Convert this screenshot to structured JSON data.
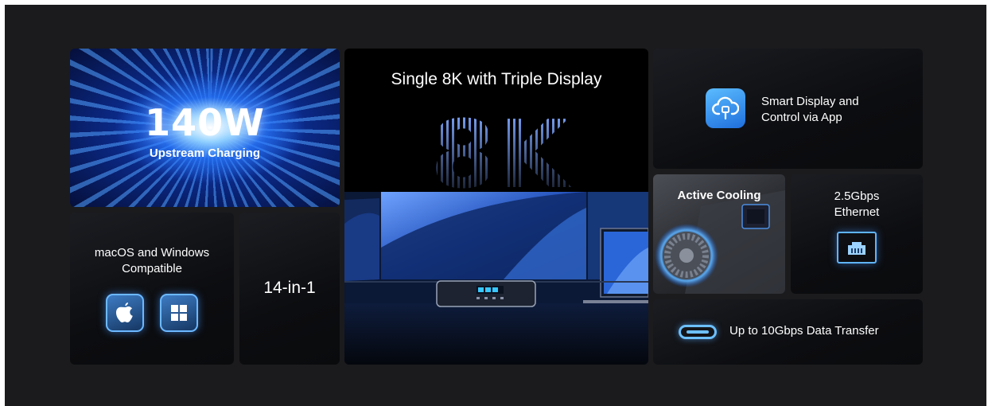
{
  "tiles": {
    "charging": {
      "headline": "140W",
      "subtitle": "Upstream Charging"
    },
    "os": {
      "title_line1": "macOS and Windows",
      "title_line2": "Compatible"
    },
    "ports": {
      "label": "14-in-1"
    },
    "display": {
      "title": "Single 8K with Triple Display",
      "graphic_text": "8K"
    },
    "app": {
      "line1": "Smart Display and",
      "line2": "Control via App"
    },
    "cooling": {
      "label": "Active Cooling"
    },
    "ethernet": {
      "line1": "2.5Gbps",
      "line2": "Ethernet"
    },
    "data": {
      "label": "Up to 10Gbps Data Transfer"
    }
  },
  "icons": {
    "os": [
      "apple-logo-icon",
      "windows-logo-icon"
    ],
    "app": "cloud-usb-icon",
    "ethernet": "ethernet-port-icon",
    "data": "usb-c-port-icon"
  },
  "colors": {
    "background": "#1b1b1d",
    "accent_blue": "#5fb4ff",
    "tile_dark": "#0c0d10"
  }
}
